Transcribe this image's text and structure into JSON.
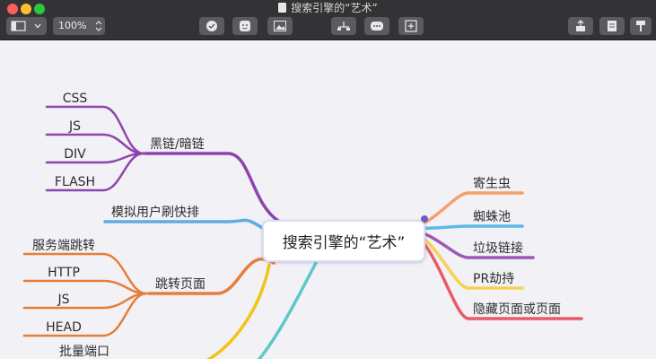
{
  "window": {
    "title": "搜索引擎的“艺术”"
  },
  "toolbar": {
    "zoom": "100%"
  },
  "mindmap": {
    "central": "搜索引擎的“艺术”",
    "left_branches": [
      {
        "label": "黑链/暗链",
        "color": "#8e44ad",
        "children": [
          "CSS",
          "JS",
          "DIV",
          "FLASH"
        ]
      },
      {
        "label": "模拟用户刷快排",
        "color": "#5dade2",
        "children": []
      },
      {
        "label": "跳转页面",
        "color": "#e67e3a",
        "children": [
          "服务端跳转",
          "HTTP",
          "JS",
          "HEAD"
        ]
      },
      {
        "label": "批量端口",
        "color": "#f0c419",
        "children": []
      }
    ],
    "right_branches": [
      {
        "label": "寄生虫",
        "color": "#f5a06a"
      },
      {
        "label": "蜘蛛池",
        "color": "#5db9e8"
      },
      {
        "label": "垃圾链接",
        "color": "#9b59b6"
      },
      {
        "label": "PR劫持",
        "color": "#f7d154"
      },
      {
        "label": "隐藏页面或页面",
        "color": "#e85a6a"
      }
    ],
    "bottom_branch_color": "#5cc9c9"
  }
}
